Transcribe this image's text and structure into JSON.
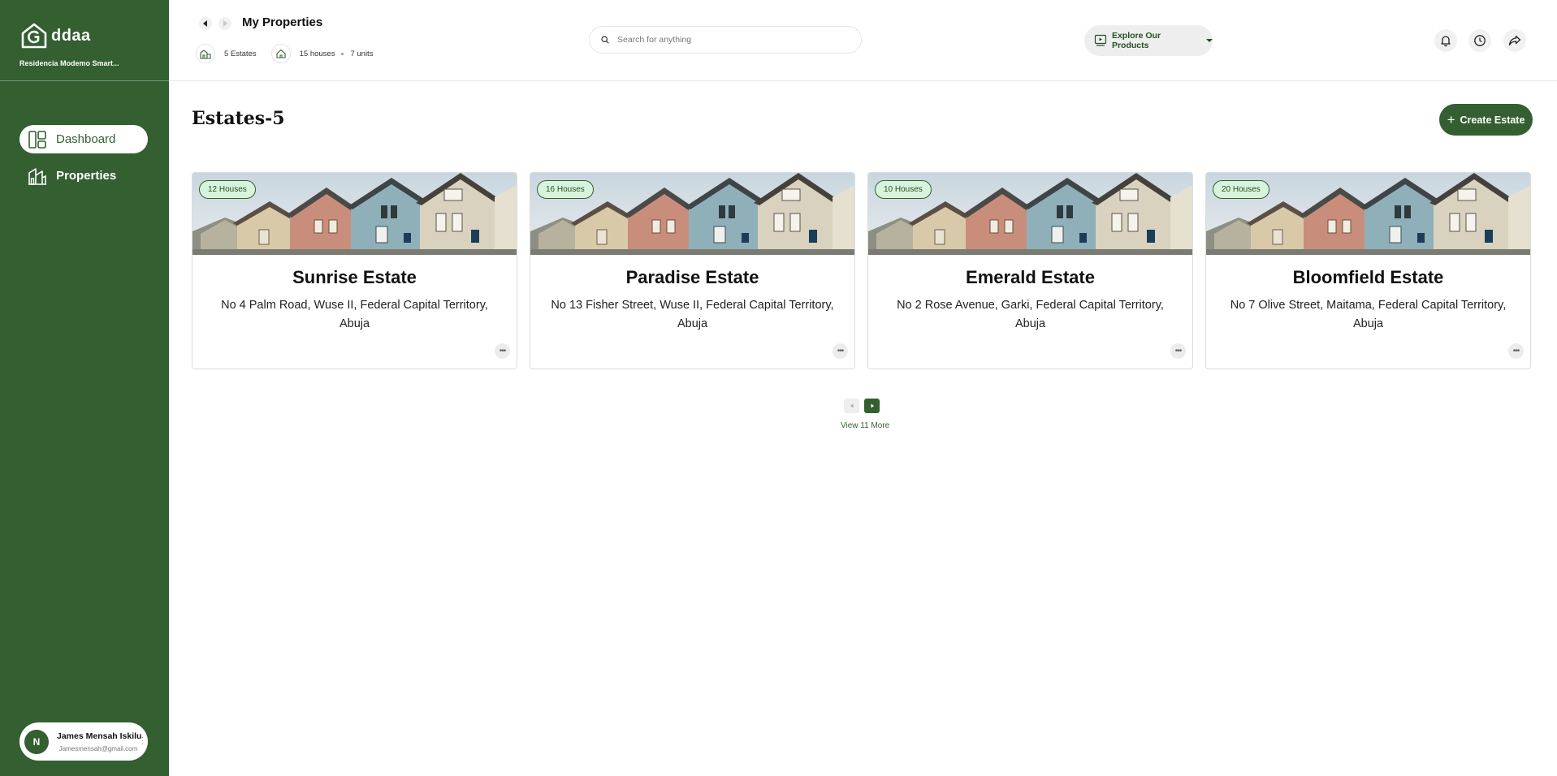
{
  "brand": {
    "name": "ddaa",
    "subtitle": "Residencia Modemo Smart..."
  },
  "sidebar": {
    "items": [
      {
        "label": "Dashboard"
      },
      {
        "label": "Properties"
      }
    ],
    "user": {
      "initial": "N",
      "name": "James Mensah Iskilu",
      "email": "Jamesmensah@gmail.com"
    }
  },
  "header": {
    "title": "My Properties",
    "stats": {
      "estates": "5 Estates",
      "houses": "15 houses",
      "units": "7 units"
    },
    "search": {
      "placeholder": "Search for anything"
    },
    "explore_label": "Explore Our Products"
  },
  "main": {
    "title": "Estates-5",
    "create_label": "Create Estate",
    "estates": [
      {
        "badge": "12 Houses",
        "name": "Sunrise Estate",
        "address": "No 4 Palm Road, Wuse II, Federal Capital Territory, Abuja"
      },
      {
        "badge": "16 Houses",
        "name": "Paradise Estate",
        "address": "No 13 Fisher Street, Wuse II, Federal Capital Territory, Abuja"
      },
      {
        "badge": "10 Houses",
        "name": "Emerald Estate",
        "address": "No 2 Rose Avenue, Garki, Federal Capital Territory, Abuja"
      },
      {
        "badge": "20 Houses",
        "name": "Bloomfield Estate",
        "address": "No 7 Olive Street, Maitama, Federal Capital Territory, Abuja"
      }
    ],
    "view_more": "View 11 More"
  },
  "colors": {
    "brand_green": "#335f31",
    "badge_bg": "#d8f3dc"
  },
  "icons": [
    "home-g-logo-icon",
    "dashboard-icon",
    "properties-icon",
    "back-arrow-icon",
    "forward-arrow-icon",
    "estate-icon",
    "house-icon",
    "search-icon",
    "video-icon",
    "caret-down-icon",
    "bell-icon",
    "clock-icon",
    "share-icon",
    "plus-icon",
    "more-icon"
  ]
}
